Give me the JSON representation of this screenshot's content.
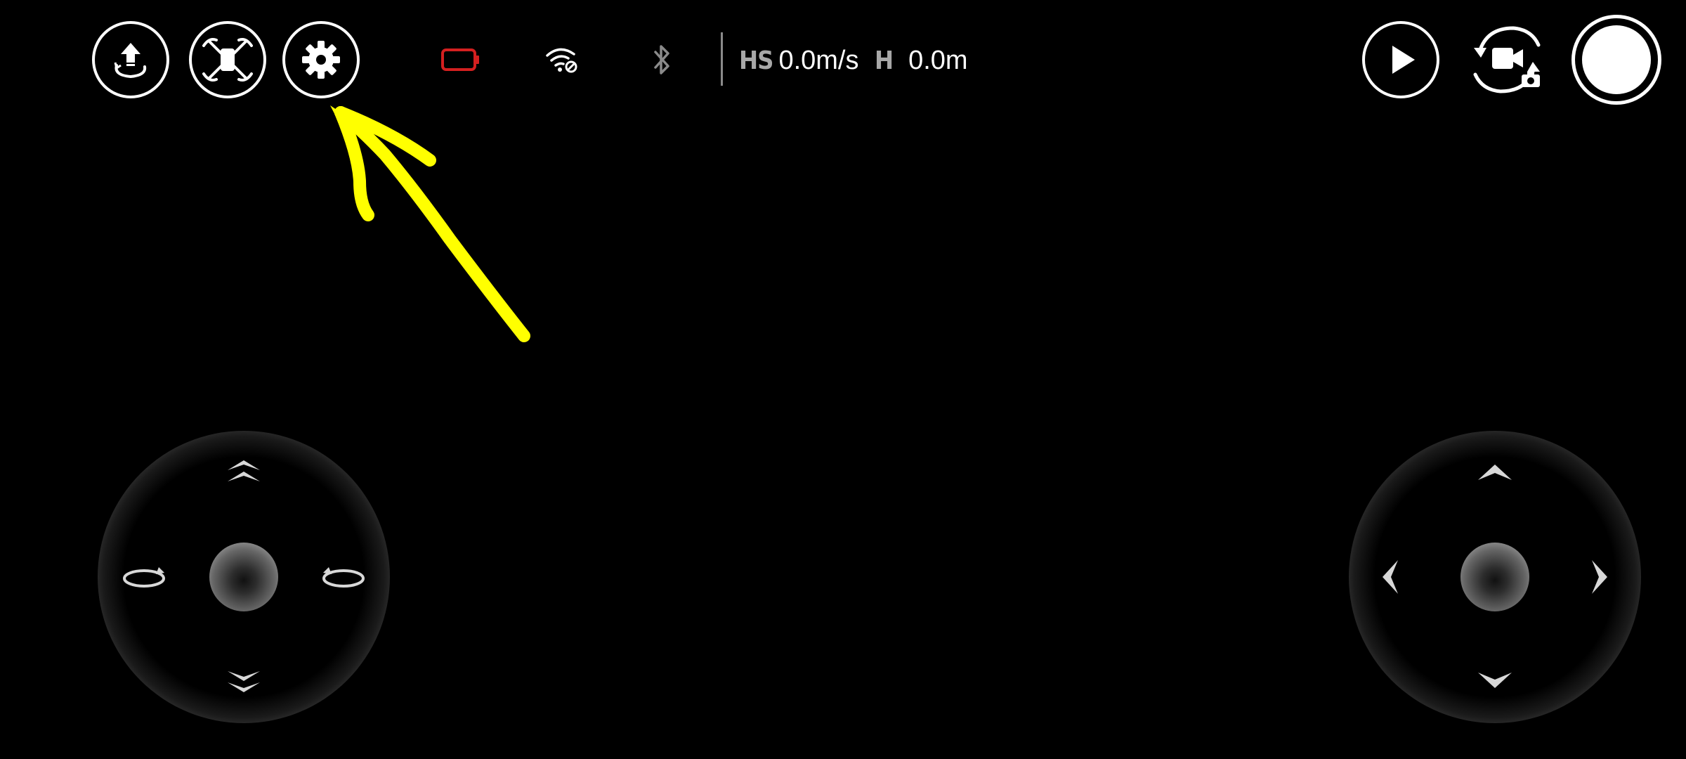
{
  "top_bar": {
    "left_buttons": [
      {
        "icon": "takeoff-icon"
      },
      {
        "icon": "drone-icon"
      },
      {
        "icon": "gear-icon"
      }
    ],
    "status": {
      "battery_icon": "battery-icon",
      "battery_color": "#d42020",
      "wifi_icon": "wifi-icon",
      "bluetooth_icon": "bluetooth-icon"
    },
    "telemetry": {
      "hs_label": "HS",
      "hs_value": "0.0m/s",
      "h_label": "H",
      "h_value": "0.0m"
    },
    "right_buttons": [
      {
        "icon": "play-icon"
      },
      {
        "icon": "camera-switch-icon"
      },
      {
        "icon": "shutter-icon"
      }
    ]
  },
  "annotation": {
    "color": "#ffff00",
    "icon": "arrow-annotation"
  },
  "joysticks": {
    "left": {
      "up": "chevron-double-up-icon",
      "down": "chevron-double-down-icon",
      "left": "rotate-left-icon",
      "right": "rotate-right-icon"
    },
    "right": {
      "up": "chevron-up-icon",
      "down": "chevron-down-icon",
      "left": "chevron-left-icon",
      "right": "chevron-right-icon"
    }
  }
}
